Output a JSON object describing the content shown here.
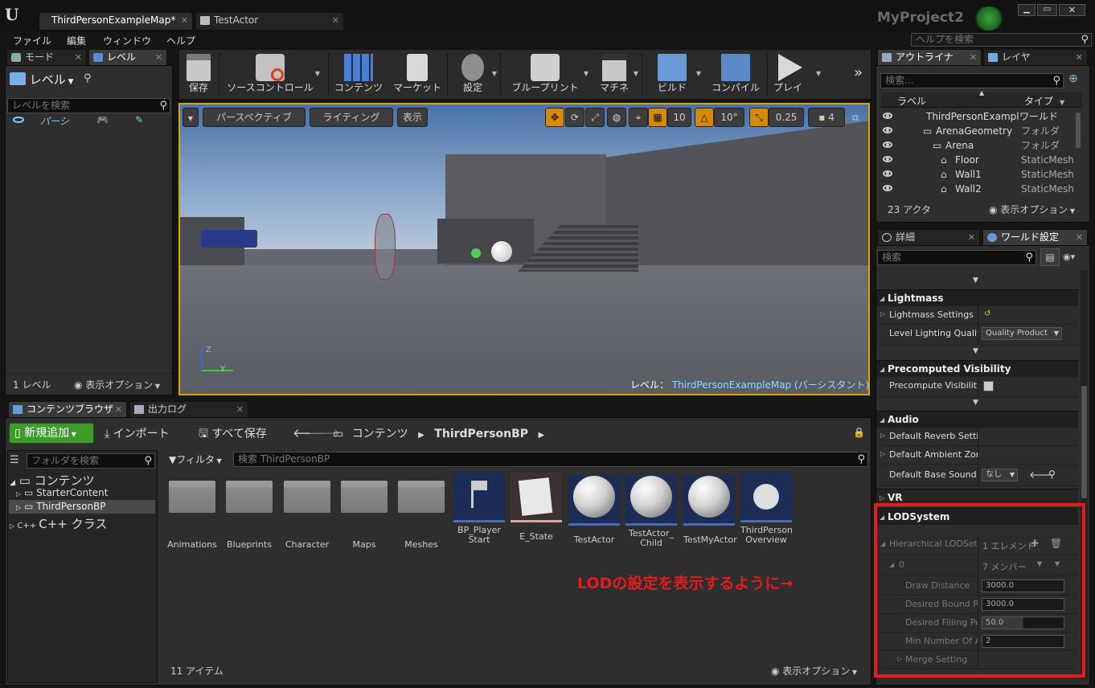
{
  "window": {
    "tabs": [
      "ThirdPersonExampleMap*",
      "TestActor"
    ],
    "project": "MyProject2",
    "help_search_placeholder": "ヘルプを検索"
  },
  "menu": [
    "ファイル",
    "編集",
    "ウィンドウ",
    "ヘルプ"
  ],
  "left_tabs": [
    "モード",
    "レベル"
  ],
  "levels": {
    "header": "レベル",
    "search_placeholder": "レベルを検索",
    "item": "パーシ",
    "footer_count": "1 レベル",
    "footer_options": "表示オプション"
  },
  "toolbar": [
    "保存",
    "ソースコントロール",
    "コンテンツ",
    "マーケット",
    "設定",
    "ブループリント",
    "マチネ",
    "ビルド",
    "コンパイル",
    "プレイ"
  ],
  "viewport": {
    "perspective": "パースペクティブ",
    "lighting": "ライティング",
    "show": "表示",
    "grid": "10",
    "rotation": "10°",
    "scale": "0.25",
    "camera_speed": "4",
    "level_label": "レベル：",
    "level_name": "ThirdPersonExampleMap (パーシスタント)",
    "axis_z": "Z",
    "axis_y": "Y"
  },
  "outliner": {
    "tabs": [
      "アウトライナ",
      "レイヤ"
    ],
    "search_placeholder": "検索...",
    "col_label": "ラベル",
    "col_type": "タイプ",
    "items": [
      {
        "label": "ThirdPersonExampleMap",
        "type": "ワールド"
      },
      {
        "label": "ArenaGeometry",
        "type": "フォルダ"
      },
      {
        "label": "Arena",
        "type": "フォルダ"
      },
      {
        "label": "Floor",
        "type": "StaticMeshActor"
      },
      {
        "label": "Wall1",
        "type": "StaticMeshActor"
      },
      {
        "label": "Wall2",
        "type": "StaticMeshActor"
      }
    ],
    "count": "23 アクタ",
    "options": "表示オプション"
  },
  "details": {
    "tabs": [
      "詳細",
      "ワールド設定"
    ],
    "search_placeholder": "検索",
    "lightmass": {
      "title": "Lightmass",
      "settings": "Lightmass Settings",
      "quality_label": "Level Lighting Quality",
      "quality_value": "Quality Product"
    },
    "precomputed": {
      "title": "Precomputed Visibility",
      "label": "Precompute Visibility"
    },
    "audio": {
      "title": "Audio",
      "reverb": "Default Reverb Setting",
      "ambient": "Default Ambient Zone",
      "sound_mix": "Default Base Sound Mix",
      "sound_mix_value": "なし"
    },
    "vr": {
      "title": "VR"
    },
    "lod": {
      "title": "LODSystem",
      "hlod": "Hierarchical LODSetup",
      "hlod_value": "1 エレメント",
      "index": "0",
      "members": "7 メンバー",
      "rows": [
        {
          "name": "Draw Distance",
          "value": "3000.0"
        },
        {
          "name": "Desired Bound Radius",
          "value": "3000.0"
        },
        {
          "name": "Desired Filling Percentage",
          "value": "50.0"
        },
        {
          "name": "Min Number Of Actors",
          "value": "2"
        }
      ],
      "merge": "Merge Setting"
    }
  },
  "content_browser": {
    "tabs": [
      "コンテンツブラウザ",
      "出力ログ"
    ],
    "add_new": "新規追加",
    "import": "インポート",
    "save_all": "すべて保存",
    "path": [
      "コンテンツ",
      "ThirdPersonBP"
    ],
    "folder_search_placeholder": "フォルダを検索",
    "filter": "フィルタ",
    "asset_search_placeholder": "検索 ThirdPersonBP",
    "tree": [
      "コンテンツ",
      "StarterContent",
      "ThirdPersonBP",
      "C++ クラス"
    ],
    "assets": [
      {
        "name": "Animations",
        "kind": "folder"
      },
      {
        "name": "Blueprints",
        "kind": "folder"
      },
      {
        "name": "Character",
        "kind": "folder"
      },
      {
        "name": "Maps",
        "kind": "folder"
      },
      {
        "name": "Meshes",
        "kind": "folder"
      },
      {
        "name": "BP_Player Start",
        "kind": "bp"
      },
      {
        "name": "E_State",
        "kind": "enum"
      },
      {
        "name": "TestActor",
        "kind": "ball"
      },
      {
        "name": "TestActor_ Child",
        "kind": "ball"
      },
      {
        "name": "TestMyActor",
        "kind": "ball"
      },
      {
        "name": "ThirdPerson Overview",
        "kind": "overview"
      }
    ],
    "count": "11 アイテム",
    "options": "表示オプション"
  },
  "annotation": {
    "text": "LODの設定を表示するように→",
    "color": "#e31c1c"
  }
}
